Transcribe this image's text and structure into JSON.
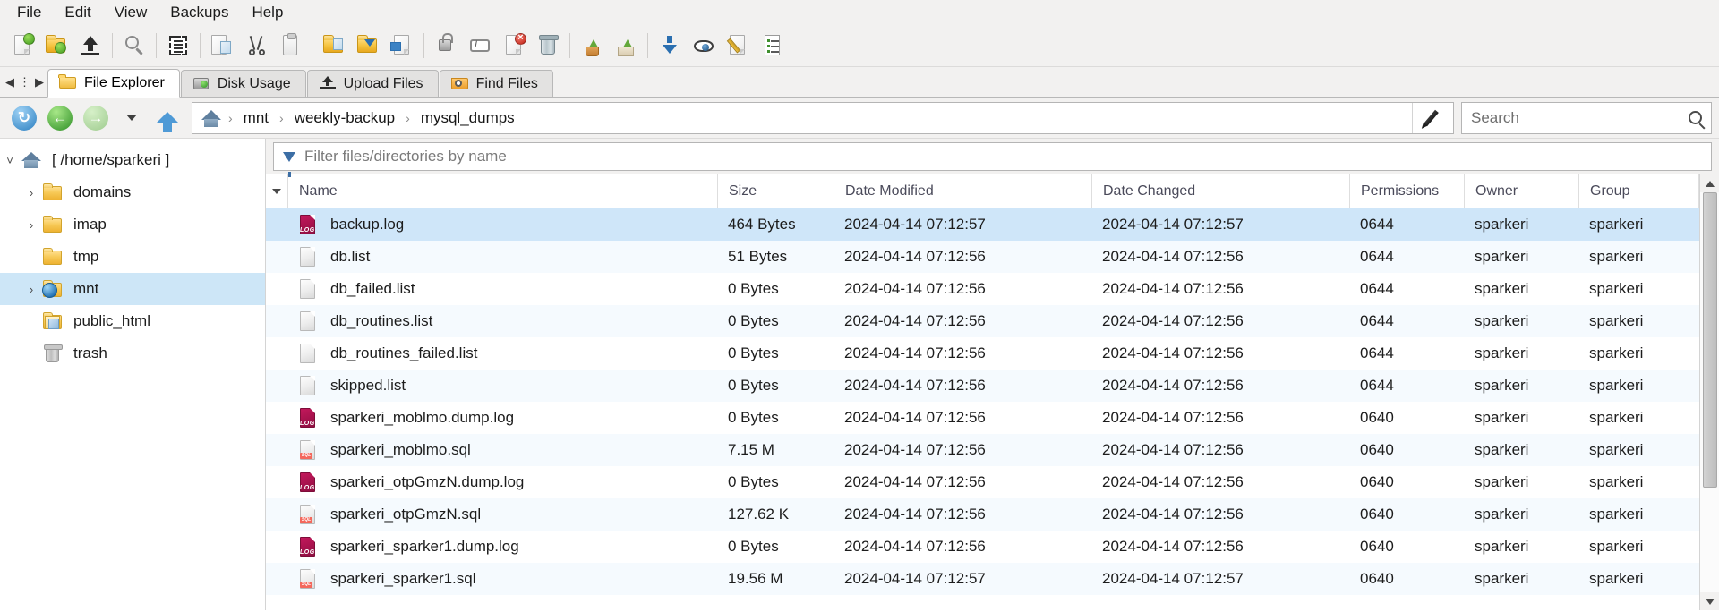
{
  "menubar": {
    "items": [
      {
        "label": "File",
        "name": "menu-file"
      },
      {
        "label": "Edit",
        "name": "menu-edit"
      },
      {
        "label": "View",
        "name": "menu-view"
      },
      {
        "label": "Backups",
        "name": "menu-backups"
      },
      {
        "label": "Help",
        "name": "menu-help"
      }
    ]
  },
  "toolbar": {
    "buttons": [
      {
        "icon": "new-file-icon",
        "label": "New File"
      },
      {
        "icon": "new-folder-icon",
        "label": "New Folder"
      },
      {
        "icon": "upload-icon",
        "label": "Upload"
      },
      {
        "icon": "search-icon",
        "label": "Search"
      },
      {
        "icon": "select-all-icon",
        "label": "Select All"
      },
      {
        "icon": "copy-icon",
        "label": "Copy"
      },
      {
        "icon": "cut-icon",
        "label": "Cut"
      },
      {
        "icon": "paste-icon",
        "label": "Paste"
      },
      {
        "icon": "move-folder-icon",
        "label": "Move"
      },
      {
        "icon": "copy-folder-icon",
        "label": "Copy To"
      },
      {
        "icon": "copy-file-icon",
        "label": "Copy File"
      },
      {
        "icon": "permissions-icon",
        "label": "Change Permissions"
      },
      {
        "icon": "rename-icon",
        "label": "Rename"
      },
      {
        "icon": "delete-file-icon",
        "label": "Delete"
      },
      {
        "icon": "trash-icon",
        "label": "Trash"
      },
      {
        "icon": "restore-icon",
        "label": "Restore"
      },
      {
        "icon": "extract-icon",
        "label": "Extract"
      },
      {
        "icon": "download-icon",
        "label": "Download"
      },
      {
        "icon": "view-icon",
        "label": "View"
      },
      {
        "icon": "edit-icon",
        "label": "Edit"
      },
      {
        "icon": "properties-icon",
        "label": "Properties"
      }
    ]
  },
  "tabs": {
    "nav_prev": "◀",
    "nav_menu": "⋮",
    "nav_next": "▶",
    "items": [
      {
        "label": "File Explorer",
        "icon": "folder-open-icon",
        "active": true
      },
      {
        "label": "Disk Usage",
        "icon": "disk-icon",
        "active": false
      },
      {
        "label": "Upload Files",
        "icon": "upload-icon",
        "active": false
      },
      {
        "label": "Find Files",
        "icon": "folder-search-icon",
        "active": false
      }
    ]
  },
  "navbar": {
    "refresh": "↻",
    "back": "←",
    "forward": "→",
    "history_caret": "▼",
    "up": "▲",
    "breadcrumb": {
      "home_icon": "home-icon",
      "separator": "›",
      "items": [
        "mnt",
        "weekly-backup",
        "mysql_dumps"
      ]
    },
    "edit_path_icon": "pencil-icon"
  },
  "search": {
    "placeholder": "Search",
    "value": "",
    "icon": "search-icon"
  },
  "filter": {
    "placeholder": "Filter files/directories by name",
    "value": "",
    "icon": "funnel-icon"
  },
  "sidebar": {
    "items": [
      {
        "label": "[ /home/sparkeri ]",
        "icon": "home-icon",
        "twisty": "˅",
        "indent": 0,
        "selected": false
      },
      {
        "label": "domains",
        "icon": "folder-icon",
        "twisty": "›",
        "indent": 1,
        "selected": false
      },
      {
        "label": "imap",
        "icon": "folder-icon",
        "twisty": "›",
        "indent": 1,
        "selected": false
      },
      {
        "label": "tmp",
        "icon": "folder-icon",
        "twisty": "",
        "indent": 1,
        "selected": false
      },
      {
        "label": "mnt",
        "icon": "globe-folder-icon",
        "twisty": "›",
        "indent": 1,
        "selected": true
      },
      {
        "label": "public_html",
        "icon": "html-folder-icon",
        "twisty": "",
        "indent": 1,
        "selected": false
      },
      {
        "label": "trash",
        "icon": "trash-icon",
        "twisty": "",
        "indent": 1,
        "selected": false
      }
    ]
  },
  "filelist": {
    "columns": [
      {
        "key": "name",
        "label": "Name"
      },
      {
        "key": "size",
        "label": "Size"
      },
      {
        "key": "date_modified",
        "label": "Date Modified"
      },
      {
        "key": "date_changed",
        "label": "Date Changed"
      },
      {
        "key": "permissions",
        "label": "Permissions"
      },
      {
        "key": "owner",
        "label": "Owner"
      },
      {
        "key": "group",
        "label": "Group"
      }
    ],
    "sort_indicator": "▼",
    "rows": [
      {
        "name": "backup.log",
        "icon": "log-file-icon",
        "size": "464 Bytes",
        "date_modified": "2024-04-14 07:12:57",
        "date_changed": "2024-04-14 07:12:57",
        "permissions": "0644",
        "owner": "sparkeri",
        "group": "sparkeri",
        "selected": true
      },
      {
        "name": "db.list",
        "icon": "generic-file-icon",
        "size": "51 Bytes",
        "date_modified": "2024-04-14 07:12:56",
        "date_changed": "2024-04-14 07:12:56",
        "permissions": "0644",
        "owner": "sparkeri",
        "group": "sparkeri",
        "selected": false
      },
      {
        "name": "db_failed.list",
        "icon": "generic-file-icon",
        "size": "0 Bytes",
        "date_modified": "2024-04-14 07:12:56",
        "date_changed": "2024-04-14 07:12:56",
        "permissions": "0644",
        "owner": "sparkeri",
        "group": "sparkeri",
        "selected": false
      },
      {
        "name": "db_routines.list",
        "icon": "generic-file-icon",
        "size": "0 Bytes",
        "date_modified": "2024-04-14 07:12:56",
        "date_changed": "2024-04-14 07:12:56",
        "permissions": "0644",
        "owner": "sparkeri",
        "group": "sparkeri",
        "selected": false
      },
      {
        "name": "db_routines_failed.list",
        "icon": "generic-file-icon",
        "size": "0 Bytes",
        "date_modified": "2024-04-14 07:12:56",
        "date_changed": "2024-04-14 07:12:56",
        "permissions": "0644",
        "owner": "sparkeri",
        "group": "sparkeri",
        "selected": false
      },
      {
        "name": "skipped.list",
        "icon": "generic-file-icon",
        "size": "0 Bytes",
        "date_modified": "2024-04-14 07:12:56",
        "date_changed": "2024-04-14 07:12:56",
        "permissions": "0644",
        "owner": "sparkeri",
        "group": "sparkeri",
        "selected": false
      },
      {
        "name": "sparkeri_moblmo.dump.log",
        "icon": "log-file-icon",
        "size": "0 Bytes",
        "date_modified": "2024-04-14 07:12:56",
        "date_changed": "2024-04-14 07:12:56",
        "permissions": "0640",
        "owner": "sparkeri",
        "group": "sparkeri",
        "selected": false
      },
      {
        "name": "sparkeri_moblmo.sql",
        "icon": "sql-file-icon",
        "size": "7.15 M",
        "date_modified": "2024-04-14 07:12:56",
        "date_changed": "2024-04-14 07:12:56",
        "permissions": "0640",
        "owner": "sparkeri",
        "group": "sparkeri",
        "selected": false
      },
      {
        "name": "sparkeri_otpGmzN.dump.log",
        "icon": "log-file-icon",
        "size": "0 Bytes",
        "date_modified": "2024-04-14 07:12:56",
        "date_changed": "2024-04-14 07:12:56",
        "permissions": "0640",
        "owner": "sparkeri",
        "group": "sparkeri",
        "selected": false
      },
      {
        "name": "sparkeri_otpGmzN.sql",
        "icon": "sql-file-icon",
        "size": "127.62 K",
        "date_modified": "2024-04-14 07:12:56",
        "date_changed": "2024-04-14 07:12:56",
        "permissions": "0640",
        "owner": "sparkeri",
        "group": "sparkeri",
        "selected": false
      },
      {
        "name": "sparkeri_sparker1.dump.log",
        "icon": "log-file-icon",
        "size": "0 Bytes",
        "date_modified": "2024-04-14 07:12:56",
        "date_changed": "2024-04-14 07:12:56",
        "permissions": "0640",
        "owner": "sparkeri",
        "group": "sparkeri",
        "selected": false
      },
      {
        "name": "sparkeri_sparker1.sql",
        "icon": "sql-file-icon",
        "size": "19.56 M",
        "date_modified": "2024-04-14 07:12:57",
        "date_changed": "2024-04-14 07:12:57",
        "permissions": "0640",
        "owner": "sparkeri",
        "group": "sparkeri",
        "selected": false
      }
    ]
  },
  "scrollbar": {
    "up_arrow": "▲",
    "down_arrow": "▼"
  },
  "colors": {
    "selection": "#cfe6f9",
    "chrome": "#f2f1f0",
    "log_icon": "#c2185b",
    "sql_icon": "#f4685c",
    "folder": "#f7c957"
  }
}
